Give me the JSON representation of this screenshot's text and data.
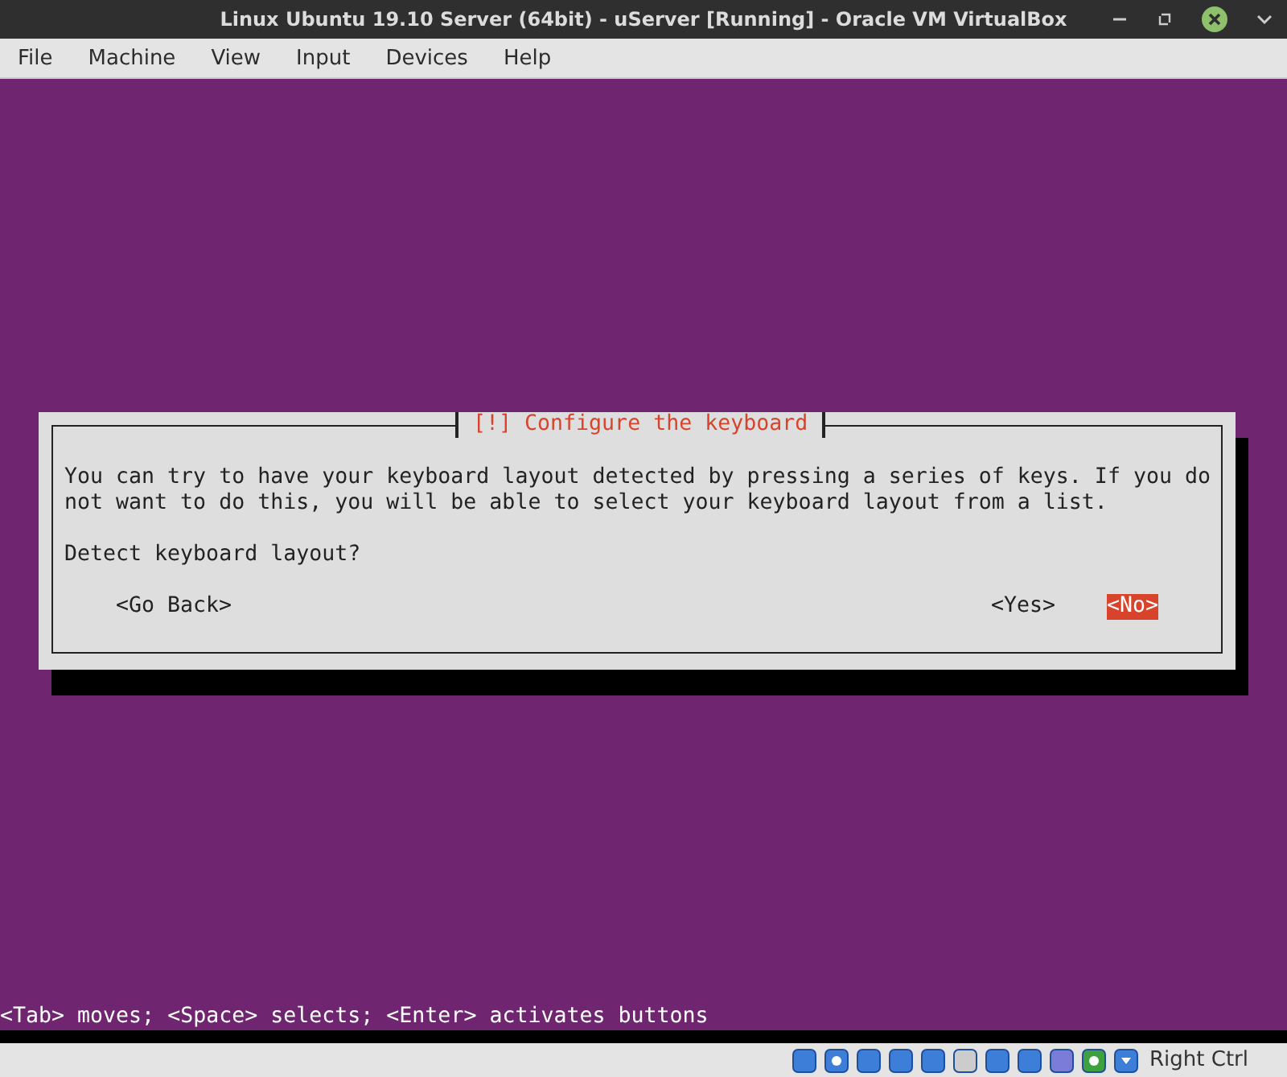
{
  "window": {
    "title": "Linux Ubuntu 19.10 Server (64bit) - uServer [Running] - Oracle VM VirtualBox"
  },
  "menu": [
    "File",
    "Machine",
    "View",
    "Input",
    "Devices",
    "Help"
  ],
  "dialog": {
    "title": "[!] Configure the keyboard",
    "message": "You can try to have your keyboard layout detected by pressing a series of keys. If you do not want to do this, you will be able to select your keyboard layout from a list.",
    "question": "Detect keyboard layout?",
    "buttons": [
      {
        "label": "<Go Back>",
        "selected": false
      },
      {
        "label": "<Yes>",
        "selected": false
      },
      {
        "label": "<No>",
        "selected": true
      }
    ]
  },
  "hint": "<Tab> moves; <Space> selects; <Enter> activates buttons",
  "status_bar": {
    "host_key": "Right Ctrl"
  }
}
